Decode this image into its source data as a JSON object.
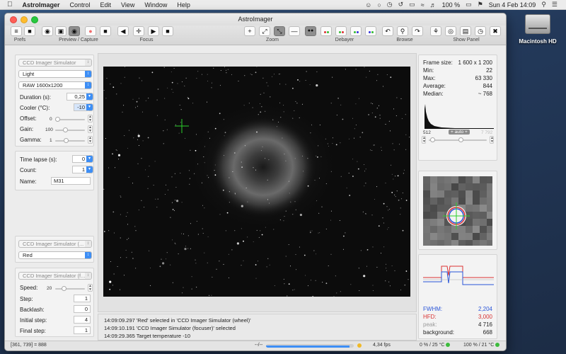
{
  "menubar": {
    "app_name": "AstroImager",
    "menus": [
      "Control",
      "Edit",
      "View",
      "Window",
      "Help"
    ],
    "battery": "100 %",
    "datetime": "Sun 4 Feb  14:09"
  },
  "desktop": {
    "disk_label": "Macintosh HD"
  },
  "window": {
    "title": "AstroImager"
  },
  "toolbar": {
    "groups": {
      "prefs": "Prefs",
      "preview_capture": "Preview / Capture",
      "focus": "Focus",
      "zoom": "Zoom",
      "debayer": "Debayer",
      "browse": "Browse",
      "show_panel": "Show Panel"
    },
    "icons": {
      "prefs": "sliders-icon",
      "open": "folder-icon",
      "preview": "eye-icon",
      "view": "frame-icon",
      "live": "eye-filled-icon",
      "record": "record-icon",
      "stop": "stop-icon",
      "focus_in": "triangle-left-icon",
      "focus_center": "crosshair-icon",
      "focus_out": "triangle-right-icon",
      "focus_stop": "stop-icon",
      "zoom_in": "plus-icon",
      "zoom_fit": "expand-icon",
      "zoom_actual": "shrink-icon",
      "zoom_out": "minus-icon",
      "browse_back": "undo-icon",
      "browse_search": "magnifier-icon",
      "browse_forward": "redo-icon"
    }
  },
  "camera_panel": {
    "device": "CCD Imager Simulator",
    "frame_type": "Light",
    "frame_format": "RAW 1600x1200",
    "duration_label": "Duration (s):",
    "duration_value": "0,25",
    "cooler_label": "Cooler (°C):",
    "cooler_value": "-10",
    "offset_label": "Offset:",
    "offset_value": "0",
    "offset_level": 0.0,
    "gain_label": "Gain:",
    "gain_value": "100",
    "gain_level": 0.3,
    "gamma_label": "Gamma:",
    "gamma_value": "1",
    "gamma_level": 0.35
  },
  "sequence_panel": {
    "time_lapse_label": "Time lapse (s):",
    "time_lapse_value": "0",
    "count_label": "Count:",
    "count_value": "1",
    "name_label": "Name:",
    "name_value": "M31"
  },
  "wheel_panel": {
    "device": "CCD Imager Simulator (...",
    "filter": "Red"
  },
  "focuser_panel": {
    "device": "CCD Imager Simulator (f...",
    "speed_label": "Speed:",
    "speed_value": "20",
    "speed_level": 0.25,
    "step_label": "Step:",
    "step_value": "1",
    "backlash_label": "Backlash:",
    "backlash_value": "0",
    "initial_step_label": "Initial step:",
    "initial_step_value": "4",
    "final_step_label": "Final step:",
    "final_step_value": "1"
  },
  "log": [
    "14:09:09.297 'Red' selected in 'CCD Imager Simulator (wheel)'",
    "14:09:10.191 'CCD Imager Simulator (focuser)' selected",
    "14:09:29.365 Target temperature -10"
  ],
  "stats": {
    "frame_size_label": "Frame size:",
    "frame_size_value": "1 600 x 1 200",
    "min_label": "Min:",
    "min_value": "22",
    "max_label": "Max:",
    "max_value": "63 330",
    "average_label": "Average:",
    "average_value": "844",
    "median_label": "Median:",
    "median_value": "~ 768",
    "hist_low": "512",
    "hist_mode": "+ auto +",
    "hist_high": "7 792"
  },
  "focus_metrics": {
    "fwhm_label": "FWHM:",
    "fwhm_value": "2,204",
    "hfd_label": "HFD:",
    "hfd_value": "3,000",
    "peak_label": "peak:",
    "peak_value": "4 716",
    "background_label": "background:",
    "background_value": "668",
    "colors": {
      "fwhm": "#2a55d8",
      "hfd": "#d83232",
      "peak": "#9a9a9a"
    }
  },
  "statusbar": {
    "cursor": "[361, 739] = 888",
    "progress_label": "--/--",
    "progress_fraction": 0.95,
    "fps": "4,34 fps",
    "cooler": "0 % / 25 °C",
    "temp": "100 % / 21 °C"
  }
}
